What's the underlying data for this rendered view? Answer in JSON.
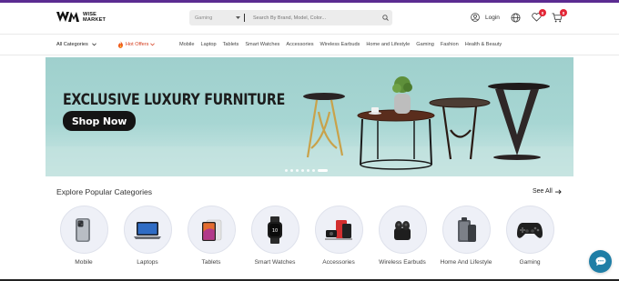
{
  "brand": {
    "logo_text_line1": "WISE",
    "logo_text_line2": "MARKET",
    "accent": "#5b2c91"
  },
  "search": {
    "category": "Gaming",
    "placeholder": "Search By Brand, Model, Color..."
  },
  "header": {
    "login_label": "Login",
    "wishlist_count": "0",
    "cart_count": "0"
  },
  "nav": {
    "all_categories": "All Categories",
    "hot_offers": "Hot Offers",
    "links": [
      "Mobile",
      "Laptop",
      "Tablets",
      "Smart Watches",
      "Accessories",
      "Wireless Earbuds",
      "Home and Lifestyle",
      "Gaming",
      "Fashion",
      "Health & Beauty"
    ]
  },
  "banner": {
    "title": "EXCLUSIVE LUXURY FURNITURE",
    "cta": "Shop Now",
    "slides": 7,
    "active_slide": 7
  },
  "categories": {
    "title": "Explore Popular Categories",
    "see_all": "See All",
    "items": [
      {
        "label": "Mobile",
        "icon": "phone-icon"
      },
      {
        "label": "Laptops",
        "icon": "laptop-icon"
      },
      {
        "label": "Tablets",
        "icon": "tablet-icon"
      },
      {
        "label": "Smart Watches",
        "icon": "smartwatch-icon"
      },
      {
        "label": "Accessories",
        "icon": "accessories-icon"
      },
      {
        "label": "Wireless Earbuds",
        "icon": "earbuds-icon"
      },
      {
        "label": "Home And Lifestyle",
        "icon": "home-lifestyle-icon"
      },
      {
        "label": "Gaming",
        "icon": "gamepad-icon"
      }
    ]
  },
  "colors": {
    "badge": "#e32636",
    "hot": "#d43a1a",
    "chat": "#1f7ea6",
    "banner_bg": "#a7d6d3"
  }
}
